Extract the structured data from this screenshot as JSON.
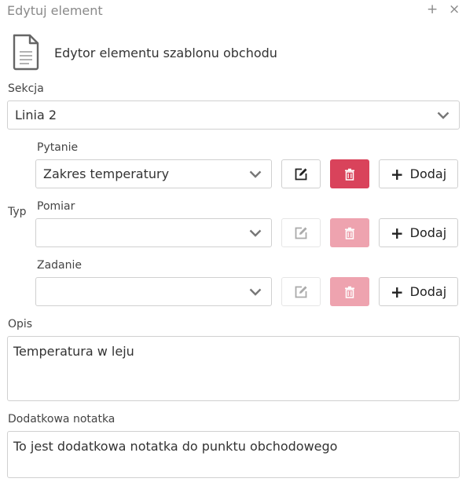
{
  "window": {
    "title": "Edytuj element",
    "plus_glyph": "+",
    "close_glyph": "×"
  },
  "header": {
    "icon": "document-icon",
    "subtitle": "Edytor elementu szablonu obchodu"
  },
  "section": {
    "label": "Sekcja",
    "value": "Linia 2"
  },
  "type": {
    "label": "Typ",
    "rows": [
      {
        "label": "Pytanie",
        "value": "Zakres temperatury",
        "enabled": true,
        "add_label": "Dodaj"
      },
      {
        "label": "Pomiar",
        "value": "",
        "enabled": false,
        "add_label": "Dodaj"
      },
      {
        "label": "Zadanie",
        "value": "",
        "enabled": false,
        "add_label": "Dodaj"
      }
    ]
  },
  "description": {
    "label": "Opis",
    "value": "Temperatura w leju"
  },
  "note": {
    "label": "Dodatkowa notatka",
    "value": "To jest dodatkowa notatka do punktu obchodowego"
  },
  "colors": {
    "delete_active": "#d9435b",
    "delete_disabled": "#eea3af",
    "title_gray": "#8a8a8a"
  }
}
